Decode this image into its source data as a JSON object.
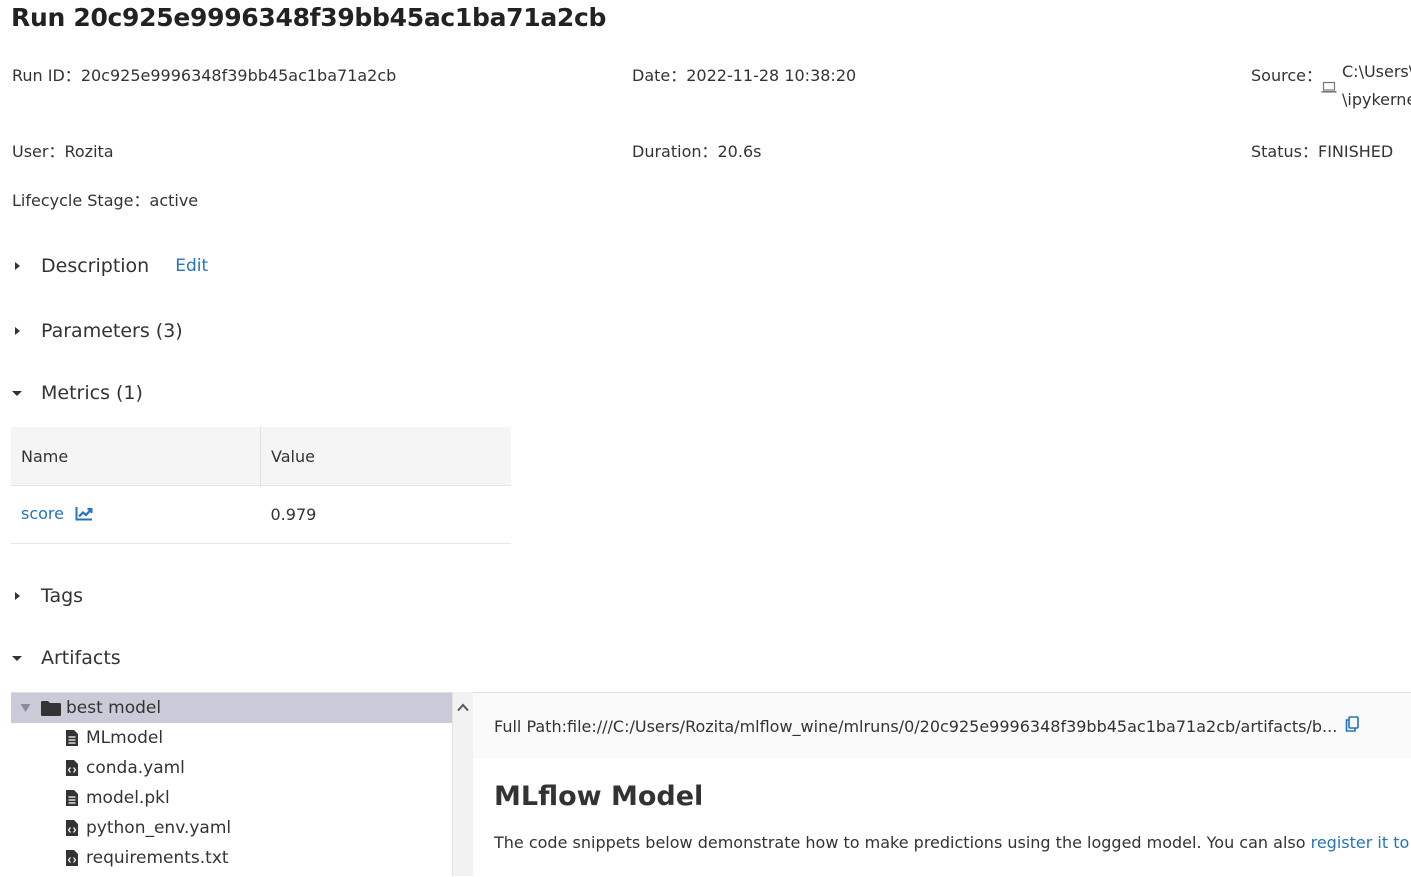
{
  "run": {
    "title": "Run 20c925e9996348f39bb45ac1ba71a2cb",
    "run_id_label": "Run ID：",
    "run_id": "20c925e9996348f39bb45ac1ba71a2cb",
    "date_label": "Date：",
    "date": "2022-11-28 10:38:20",
    "source_label": "Source：",
    "source_line1": "C:\\Users\\",
    "source_line2": "\\ipykerne",
    "source_icon": "laptop-icon",
    "user_label": "User：",
    "user": "Rozita",
    "duration_label": "Duration：",
    "duration": "20.6s",
    "status_label": "Status：",
    "status": "FINISHED",
    "lifecycle_label": "Lifecycle Stage：",
    "lifecycle": "active"
  },
  "sections": {
    "description": {
      "label": "Description",
      "edit": "Edit",
      "expanded": false
    },
    "parameters": {
      "label": "Parameters (3)",
      "expanded": false
    },
    "metrics": {
      "label": "Metrics (1)",
      "expanded": true
    },
    "tags": {
      "label": "Tags",
      "expanded": false
    },
    "artifacts": {
      "label": "Artifacts",
      "expanded": true
    }
  },
  "metrics_table": {
    "headers": [
      "Name",
      "Value"
    ],
    "rows": [
      {
        "name": "score",
        "value": "0.979",
        "icon": "line-chart-icon"
      }
    ]
  },
  "artifacts": {
    "tree": [
      {
        "label": "best model",
        "type": "folder",
        "expanded": true,
        "selected": true
      },
      {
        "label": "MLmodel",
        "type": "file"
      },
      {
        "label": "conda.yaml",
        "type": "code-file"
      },
      {
        "label": "model.pkl",
        "type": "file"
      },
      {
        "label": "python_env.yaml",
        "type": "code-file"
      },
      {
        "label": "requirements.txt",
        "type": "code-file"
      }
    ],
    "full_path": "Full Path:file:///C:/Users/Rozita/mlflow_wine/mlruns/0/20c925e9996348f39bb45ac1ba71a2cb/artifacts/b...",
    "copy_icon": "copy-icon",
    "model_title": "MLflow Model",
    "model_desc": "The code snippets below demonstrate how to make predictions using the logged model. You can also ",
    "model_desc_link": "register it to the"
  },
  "colors": {
    "link": "#2374bb",
    "selected_row": "#c9ccd8",
    "header_bg": "#f5f5f5"
  }
}
